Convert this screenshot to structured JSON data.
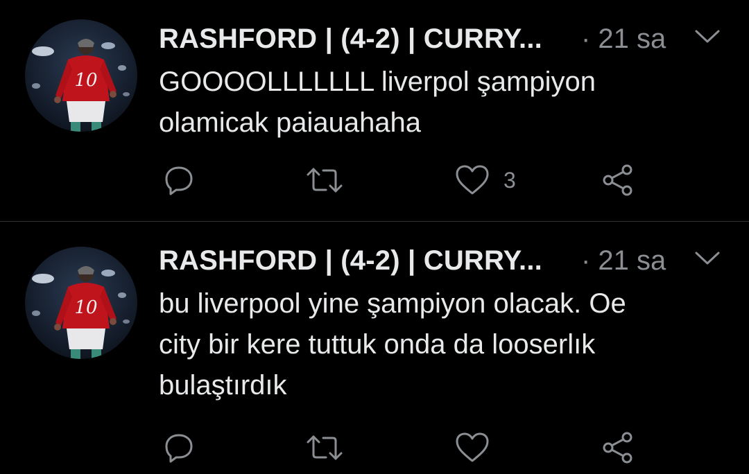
{
  "tweets": [
    {
      "author": "RASHFORD | (4-2) | CURRY...",
      "time": "· 21 sa",
      "text_lines": [
        "GOOOOLLLLLLL liverpol şampiyon",
        "olamicak paiauahaha"
      ],
      "reply_count": "",
      "retweet_count": "",
      "like_count": "3",
      "avatar": "player-number-10-red-jersey"
    },
    {
      "author": "RASHFORD | (4-2) | CURRY...",
      "time": "· 21 sa",
      "text_lines": [
        "bu liverpool yine şampiyon olacak. Oe",
        "city bir kere tuttuk onda da looserlık",
        "bulaştırdık"
      ],
      "reply_count": "",
      "retweet_count": "",
      "like_count": "",
      "avatar": "player-number-10-red-jersey"
    }
  ],
  "avatar_jersey_number": "10",
  "icons": {
    "reply": "reply-icon",
    "retweet": "retweet-icon",
    "like": "heart-icon",
    "share": "share-icon",
    "menu": "chevron-down-icon"
  },
  "colors": {
    "background": "#000000",
    "primary_text": "#e7e9ea",
    "secondary_text": "#8b8f93",
    "divider": "#2f3336"
  }
}
